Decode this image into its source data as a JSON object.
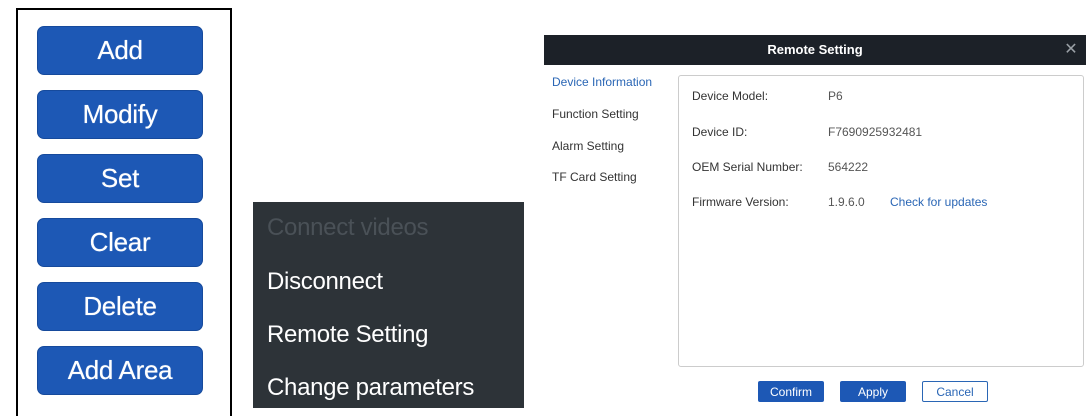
{
  "button_panel": {
    "buttons": [
      {
        "label": "Add"
      },
      {
        "label": "Modify"
      },
      {
        "label": "Set"
      },
      {
        "label": "Clear"
      },
      {
        "label": "Delete"
      },
      {
        "label": "Add Area"
      }
    ],
    "colors": {
      "button_bg": "#1d58b5",
      "button_text": "#ffffff"
    }
  },
  "context_menu": {
    "items": [
      {
        "label": "Connect videos",
        "enabled": false
      },
      {
        "label": "Disconnect",
        "enabled": true
      },
      {
        "label": "Remote Setting",
        "enabled": true
      },
      {
        "label": "Change parameters",
        "enabled": true
      }
    ],
    "colors": {
      "bg": "#2d3338",
      "text": "#ffffff",
      "disabled_text": "#4a5157"
    }
  },
  "dialog": {
    "title": "Remote Setting",
    "close_icon": "close-icon",
    "nav": [
      {
        "label": "Device Information",
        "active": true
      },
      {
        "label": "Function Setting",
        "active": false
      },
      {
        "label": "Alarm Setting",
        "active": false
      },
      {
        "label": "TF Card Setting",
        "active": false
      }
    ],
    "info": {
      "device_model": {
        "label": "Device Model:",
        "value": "P6"
      },
      "device_id": {
        "label": "Device ID:",
        "value": "F7690925932481"
      },
      "oem_serial": {
        "label": "OEM Serial Number:",
        "value": "564222"
      },
      "firmware": {
        "label": "Firmware Version:",
        "value": "1.9.6.0",
        "link": "Check for updates"
      }
    },
    "buttons": {
      "confirm": "Confirm",
      "apply": "Apply",
      "cancel": "Cancel"
    },
    "colors": {
      "titlebar": "#1c2128",
      "accent": "#2a66b5"
    }
  }
}
